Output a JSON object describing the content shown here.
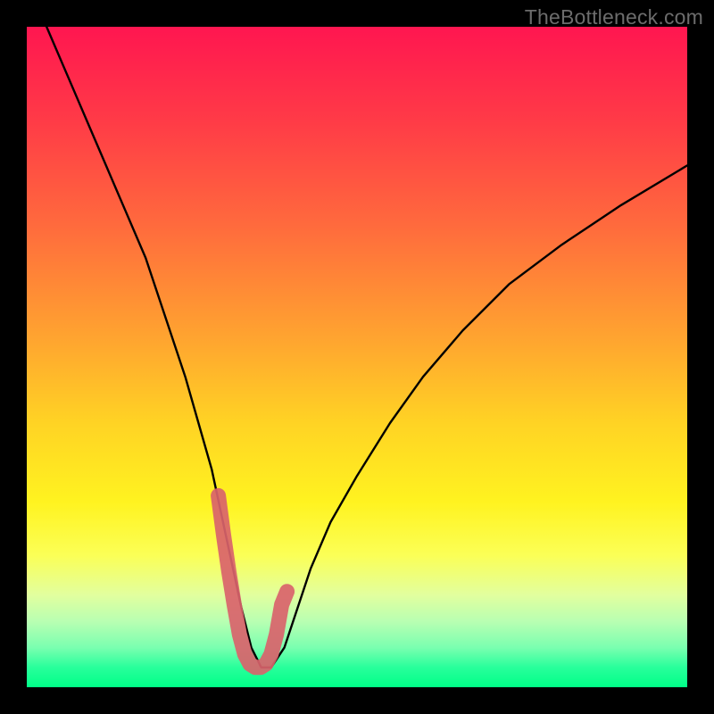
{
  "watermark": "TheBottleneck.com",
  "chart_data": {
    "type": "line",
    "title": "",
    "xlabel": "",
    "ylabel": "",
    "xlim": [
      0,
      100
    ],
    "ylim": [
      0,
      100
    ],
    "series": [
      {
        "name": "bottleneck-curve",
        "x": [
          3,
          6,
          9,
          12,
          15,
          18,
          20,
          22,
          24,
          26,
          28,
          29.5,
          31,
          32.5,
          34,
          35.5,
          37,
          39,
          41,
          43,
          46,
          50,
          55,
          60,
          66,
          73,
          81,
          90,
          100
        ],
        "values": [
          100,
          93,
          86,
          79,
          72,
          65,
          59,
          53,
          47,
          40,
          33,
          26,
          19,
          12,
          6,
          3,
          3,
          6,
          12,
          18,
          25,
          32,
          40,
          47,
          54,
          61,
          67,
          73,
          79
        ]
      },
      {
        "name": "bottleneck-sweet-spot",
        "x": [
          29.0,
          29.8,
          30.6,
          31.4,
          32.2,
          33.0,
          33.8,
          34.6,
          35.4,
          36.2,
          37.0,
          37.8,
          38.6,
          39.4
        ],
        "values": [
          29.0,
          23.0,
          17.5,
          12.5,
          8.0,
          5.0,
          3.5,
          3.0,
          3.0,
          3.5,
          5.0,
          8.0,
          12.5,
          14.5
        ]
      }
    ],
    "annotations": []
  }
}
